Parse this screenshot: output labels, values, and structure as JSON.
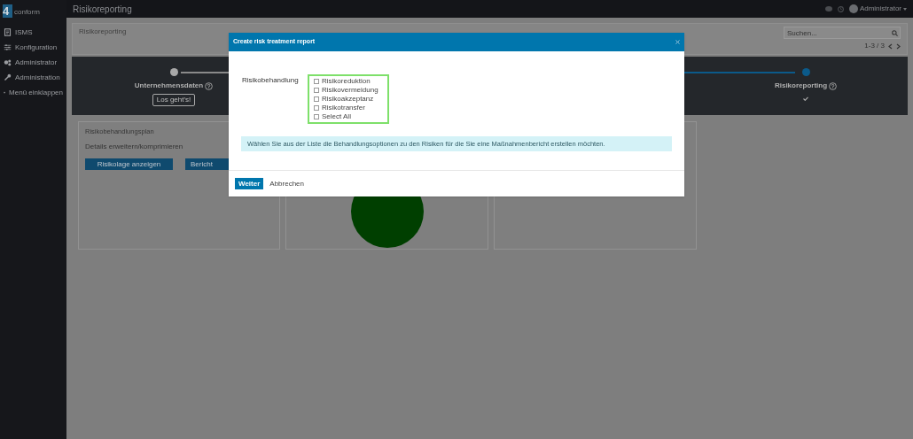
{
  "logo": {
    "mark": "4",
    "name": "conform"
  },
  "sidebar": {
    "items": [
      {
        "label": "ISMS"
      },
      {
        "label": "Konfiguration"
      },
      {
        "label": "Administrator"
      },
      {
        "label": "Administration"
      },
      {
        "label": "Menü einklappen"
      }
    ]
  },
  "topbar": {
    "title": "Risikoreporting",
    "user": "Administrator"
  },
  "page": {
    "title": "Risikoreporting",
    "search": {
      "placeholder": "Suchen..."
    },
    "pagination": "1-3 / 3"
  },
  "steps": [
    {
      "label": "Unternehmensdaten",
      "button": "Los geht's!",
      "done": false
    },
    {
      "label": "Risikoreporting",
      "done": true
    }
  ],
  "cards": [
    {
      "title": "Risikobehandlungsplan",
      "subtitle": "Details erweitern/komprimieren",
      "buttons": [
        "Risikolage anzeigen",
        "Bericht"
      ]
    },
    {
      "kind": "pie"
    },
    {
      "kind": "empty"
    }
  ],
  "modal": {
    "title": "Create risk treatment report",
    "field_label": "Risikobehandlung",
    "options": [
      {
        "label": "Risikoreduktion",
        "checked": false
      },
      {
        "label": "Risikovermeidung",
        "checked": false
      },
      {
        "label": "Risikoakzeptanz",
        "checked": false
      },
      {
        "label": "Risikotransfer",
        "checked": false
      },
      {
        "label": "Select All",
        "checked": false
      }
    ],
    "info": "Wählen Sie aus der Liste die Behandlungsoptionen zu den Risiken für die Sie eine Maßnahmenbericht erstellen möchten.",
    "primary": "Weiter",
    "secondary": "Abbrechen"
  }
}
